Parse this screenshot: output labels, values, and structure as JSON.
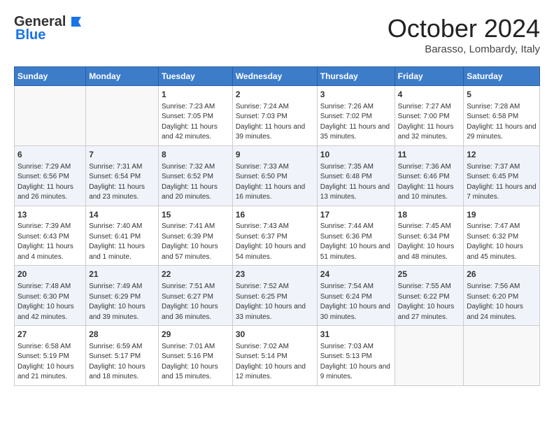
{
  "header": {
    "logo_general": "General",
    "logo_blue": "Blue",
    "month_title": "October 2024",
    "location": "Barasso, Lombardy, Italy"
  },
  "weekdays": [
    "Sunday",
    "Monday",
    "Tuesday",
    "Wednesday",
    "Thursday",
    "Friday",
    "Saturday"
  ],
  "weeks": [
    [
      {
        "day": "",
        "content": ""
      },
      {
        "day": "",
        "content": ""
      },
      {
        "day": "1",
        "content": "Sunrise: 7:23 AM\nSunset: 7:05 PM\nDaylight: 11 hours\nand 42 minutes."
      },
      {
        "day": "2",
        "content": "Sunrise: 7:24 AM\nSunset: 7:03 PM\nDaylight: 11 hours\nand 39 minutes."
      },
      {
        "day": "3",
        "content": "Sunrise: 7:26 AM\nSunset: 7:02 PM\nDaylight: 11 hours\nand 35 minutes."
      },
      {
        "day": "4",
        "content": "Sunrise: 7:27 AM\nSunset: 7:00 PM\nDaylight: 11 hours\nand 32 minutes."
      },
      {
        "day": "5",
        "content": "Sunrise: 7:28 AM\nSunset: 6:58 PM\nDaylight: 11 hours\nand 29 minutes."
      }
    ],
    [
      {
        "day": "6",
        "content": "Sunrise: 7:29 AM\nSunset: 6:56 PM\nDaylight: 11 hours\nand 26 minutes."
      },
      {
        "day": "7",
        "content": "Sunrise: 7:31 AM\nSunset: 6:54 PM\nDaylight: 11 hours\nand 23 minutes."
      },
      {
        "day": "8",
        "content": "Sunrise: 7:32 AM\nSunset: 6:52 PM\nDaylight: 11 hours\nand 20 minutes."
      },
      {
        "day": "9",
        "content": "Sunrise: 7:33 AM\nSunset: 6:50 PM\nDaylight: 11 hours\nand 16 minutes."
      },
      {
        "day": "10",
        "content": "Sunrise: 7:35 AM\nSunset: 6:48 PM\nDaylight: 11 hours\nand 13 minutes."
      },
      {
        "day": "11",
        "content": "Sunrise: 7:36 AM\nSunset: 6:46 PM\nDaylight: 11 hours\nand 10 minutes."
      },
      {
        "day": "12",
        "content": "Sunrise: 7:37 AM\nSunset: 6:45 PM\nDaylight: 11 hours\nand 7 minutes."
      }
    ],
    [
      {
        "day": "13",
        "content": "Sunrise: 7:39 AM\nSunset: 6:43 PM\nDaylight: 11 hours\nand 4 minutes."
      },
      {
        "day": "14",
        "content": "Sunrise: 7:40 AM\nSunset: 6:41 PM\nDaylight: 11 hours\nand 1 minute."
      },
      {
        "day": "15",
        "content": "Sunrise: 7:41 AM\nSunset: 6:39 PM\nDaylight: 10 hours\nand 57 minutes."
      },
      {
        "day": "16",
        "content": "Sunrise: 7:43 AM\nSunset: 6:37 PM\nDaylight: 10 hours\nand 54 minutes."
      },
      {
        "day": "17",
        "content": "Sunrise: 7:44 AM\nSunset: 6:36 PM\nDaylight: 10 hours\nand 51 minutes."
      },
      {
        "day": "18",
        "content": "Sunrise: 7:45 AM\nSunset: 6:34 PM\nDaylight: 10 hours\nand 48 minutes."
      },
      {
        "day": "19",
        "content": "Sunrise: 7:47 AM\nSunset: 6:32 PM\nDaylight: 10 hours\nand 45 minutes."
      }
    ],
    [
      {
        "day": "20",
        "content": "Sunrise: 7:48 AM\nSunset: 6:30 PM\nDaylight: 10 hours\nand 42 minutes."
      },
      {
        "day": "21",
        "content": "Sunrise: 7:49 AM\nSunset: 6:29 PM\nDaylight: 10 hours\nand 39 minutes."
      },
      {
        "day": "22",
        "content": "Sunrise: 7:51 AM\nSunset: 6:27 PM\nDaylight: 10 hours\nand 36 minutes."
      },
      {
        "day": "23",
        "content": "Sunrise: 7:52 AM\nSunset: 6:25 PM\nDaylight: 10 hours\nand 33 minutes."
      },
      {
        "day": "24",
        "content": "Sunrise: 7:54 AM\nSunset: 6:24 PM\nDaylight: 10 hours\nand 30 minutes."
      },
      {
        "day": "25",
        "content": "Sunrise: 7:55 AM\nSunset: 6:22 PM\nDaylight: 10 hours\nand 27 minutes."
      },
      {
        "day": "26",
        "content": "Sunrise: 7:56 AM\nSunset: 6:20 PM\nDaylight: 10 hours\nand 24 minutes."
      }
    ],
    [
      {
        "day": "27",
        "content": "Sunrise: 6:58 AM\nSunset: 5:19 PM\nDaylight: 10 hours\nand 21 minutes."
      },
      {
        "day": "28",
        "content": "Sunrise: 6:59 AM\nSunset: 5:17 PM\nDaylight: 10 hours\nand 18 minutes."
      },
      {
        "day": "29",
        "content": "Sunrise: 7:01 AM\nSunset: 5:16 PM\nDaylight: 10 hours\nand 15 minutes."
      },
      {
        "day": "30",
        "content": "Sunrise: 7:02 AM\nSunset: 5:14 PM\nDaylight: 10 hours\nand 12 minutes."
      },
      {
        "day": "31",
        "content": "Sunrise: 7:03 AM\nSunset: 5:13 PM\nDaylight: 10 hours\nand 9 minutes."
      },
      {
        "day": "",
        "content": ""
      },
      {
        "day": "",
        "content": ""
      }
    ]
  ]
}
